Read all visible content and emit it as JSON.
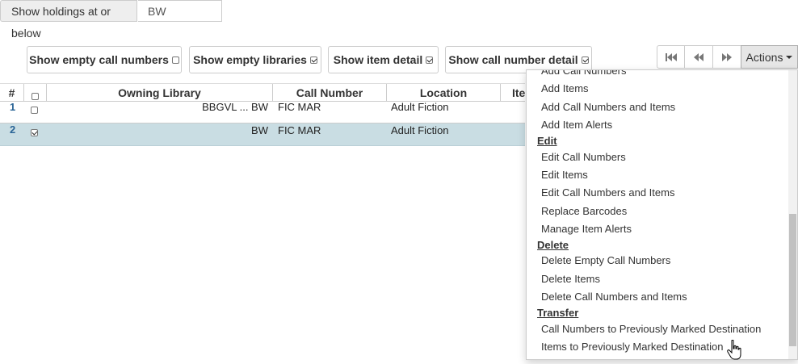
{
  "holdings": {
    "label": "Show holdings at or below",
    "value": "BW"
  },
  "toggles": [
    {
      "label": "Show empty call numbers",
      "checked": false
    },
    {
      "label": "Show empty libraries",
      "checked": true
    },
    {
      "label": "Show item detail",
      "checked": true
    },
    {
      "label": "Show call number detail",
      "checked": true
    }
  ],
  "pager": {
    "first_icon": "first-page-icon",
    "prev_icon": "previous-page-icon",
    "next_icon": "next-page-icon",
    "actions_label": "Actions"
  },
  "grid": {
    "columns": [
      "#",
      "Owning Library",
      "Call Number",
      "Location",
      "Item"
    ],
    "rows": [
      {
        "num": "1",
        "selected": false,
        "library": "BBGVL ... BW",
        "call_number": "FIC MAR",
        "location": "Adult Fiction"
      },
      {
        "num": "2",
        "selected": true,
        "library": "BW",
        "call_number": "FIC MAR",
        "location": "Adult Fiction"
      }
    ]
  },
  "menu": {
    "items": [
      {
        "type": "item",
        "label": "Add Call Numbers"
      },
      {
        "type": "item",
        "label": "Add Items"
      },
      {
        "type": "item",
        "label": "Add Call Numbers and Items"
      },
      {
        "type": "item",
        "label": "Add Item Alerts"
      },
      {
        "type": "header",
        "label": "Edit"
      },
      {
        "type": "item",
        "label": "Edit Call Numbers"
      },
      {
        "type": "item",
        "label": "Edit Items"
      },
      {
        "type": "item",
        "label": "Edit Call Numbers and Items"
      },
      {
        "type": "item",
        "label": "Replace Barcodes"
      },
      {
        "type": "item",
        "label": "Manage Item Alerts"
      },
      {
        "type": "header",
        "label": "Delete"
      },
      {
        "type": "item",
        "label": "Delete Empty Call Numbers"
      },
      {
        "type": "item",
        "label": "Delete Items"
      },
      {
        "type": "item",
        "label": "Delete Call Numbers and Items"
      },
      {
        "type": "header",
        "label": "Transfer"
      },
      {
        "type": "item",
        "label": "Call Numbers to Previously Marked Destination"
      },
      {
        "type": "item",
        "label": "Items to Previously Marked Destination"
      }
    ]
  },
  "colors": {
    "selected_row": "#c9dde3",
    "row_number": "#2a6496",
    "actions_bg": "#e6e6e6"
  }
}
